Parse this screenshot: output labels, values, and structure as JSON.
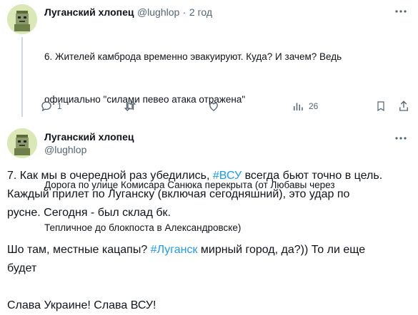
{
  "tweet1": {
    "author_name": "Луганский хлопец",
    "handle": "@lughlop",
    "separator": "·",
    "time": "2 год",
    "text_line1": "6. Жителей камброда временно эвакуируют. Куда? И зачем? Ведь",
    "text_line2": "официально \"силами певео атака отражена\"",
    "text_line3": "Дорога по улице Комисара Санюка перекрыта (от Любавы через",
    "text_line4": "Тепличное до блокпоста в Александровске)",
    "reply_count": "1",
    "views_count": "26",
    "more_icon": "more-icon"
  },
  "tweet2": {
    "author_name": "Луганский хлопец",
    "handle": "@lughlop",
    "p1_a": "7. Как мы в очередной раз убедились, ",
    "p1_hashtag": "#ВСУ",
    "p1_b": " всегда бьют точно в цель.",
    "p1_line2": "Каждый прилет по Луганску (включая сегодняшний), это удар по",
    "p1_line3": "русне. Сегодня - был склад бк.",
    "p2_a": "Шо там, местные кацапы? ",
    "p2_hashtag": "#Луганск",
    "p2_b": " мирный город, да?)) То ли еще",
    "p2_line2": "будет",
    "p3": "Слава Украине! Слава ВСУ!"
  },
  "colors": {
    "text": "#0f1419",
    "secondary": "#536471",
    "link": "#1d9bf0",
    "divider": "#cfd9de"
  }
}
